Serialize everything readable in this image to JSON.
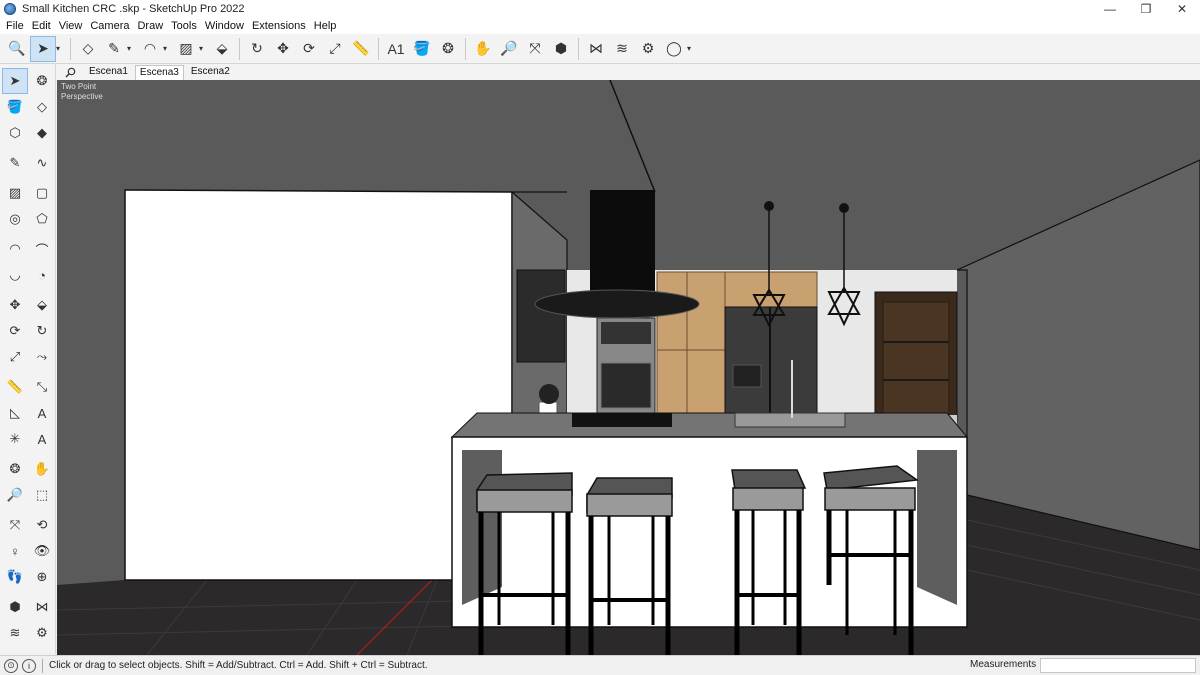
{
  "window": {
    "title": "Small Kitchen CRC .skp - SketchUp Pro 2022",
    "controls": [
      "—",
      "❐",
      "✕"
    ]
  },
  "menu": [
    "File",
    "Edit",
    "View",
    "Camera",
    "Draw",
    "Tools",
    "Window",
    "Extensions",
    "Help"
  ],
  "toolbar": {
    "tools": [
      {
        "name": "search-icon",
        "glyph": "🔍"
      },
      {
        "name": "select-icon",
        "glyph": "➤",
        "active": true,
        "dropdown": true
      },
      {
        "name": "eraser-icon",
        "glyph": "◇"
      },
      {
        "name": "pencil-icon",
        "glyph": "✎",
        "dropdown": true
      },
      {
        "name": "arc-icon",
        "glyph": "◠",
        "dropdown": true
      },
      {
        "name": "rectangle-icon",
        "glyph": "▨",
        "dropdown": true
      },
      {
        "name": "push-pull-icon",
        "glyph": "⬙"
      },
      {
        "name": "follow-me-icon",
        "glyph": "↻"
      },
      {
        "name": "move-icon",
        "glyph": "✥"
      },
      {
        "name": "rotate-icon",
        "glyph": "⟳"
      },
      {
        "name": "scale-icon",
        "glyph": "⤢"
      },
      {
        "name": "tape-measure-icon",
        "glyph": "📏"
      },
      {
        "name": "text-icon",
        "glyph": "A1"
      },
      {
        "name": "paint-bucket-icon",
        "glyph": "🪣"
      },
      {
        "name": "orbit-icon",
        "glyph": "❂"
      },
      {
        "name": "pan-icon",
        "glyph": "✋"
      },
      {
        "name": "zoom-icon",
        "glyph": "🔎"
      },
      {
        "name": "zoom-extents-icon",
        "glyph": "⤧"
      },
      {
        "name": "warehouse-icon",
        "glyph": "⬢"
      },
      {
        "name": "extension-warehouse-icon",
        "glyph": "⋈"
      },
      {
        "name": "layout-icon",
        "glyph": "≋"
      },
      {
        "name": "extension-manager-icon",
        "glyph": "⚙"
      },
      {
        "name": "account-icon",
        "glyph": "◯",
        "dropdown": true
      }
    ]
  },
  "scenes": {
    "tabs": [
      {
        "label": "Escena1",
        "active": false
      },
      {
        "label": "Escena3",
        "active": true
      },
      {
        "label": "Escena2",
        "active": false
      }
    ]
  },
  "lefttools": [
    "select-icon",
    "orbit-icon",
    "paint-bucket-icon",
    "eraser-icon",
    "make-component-icon",
    "tag-icon",
    "pencil-icon",
    "freehand-icon",
    "rectangle-icon",
    "rotated-rectangle-icon",
    "circle-icon",
    "polygon-icon",
    "arc-icon",
    "two-point-arc-icon",
    "three-point-arc-icon",
    "pie-icon",
    "move-icon",
    "push-pull-icon",
    "rotate-icon",
    "follow-me-icon",
    "scale-icon",
    "offset-icon",
    "tape-measure-icon",
    "dimension-icon",
    "protractor-icon",
    "text-icon",
    "axes-icon",
    "3d-text-icon",
    "orbit-icon",
    "pan-icon",
    "zoom-icon",
    "zoom-window-icon",
    "zoom-extents-icon",
    "previous-view-icon",
    "position-camera-icon",
    "look-around-icon",
    "walk-icon",
    "section-plane-icon",
    "warehouse-icon",
    "extension-warehouse-icon",
    "layout-icon",
    "extension-manager-icon"
  ],
  "viewport": {
    "camera_label_1": "Two Point",
    "camera_label_2": "Perspective"
  },
  "status": {
    "hint": "Click or drag to select objects. Shift = Add/Subtract. Ctrl = Add. Shift + Ctrl = Subtract.",
    "measurements_label": "Measurements",
    "measurements_value": ""
  },
  "colors": {
    "ceiling": "#5b5b5b",
    "wall_left": "#ffffff",
    "floor": "#2a2828",
    "wood": "#c9a070",
    "accent_blue": "#1a5fa8"
  }
}
